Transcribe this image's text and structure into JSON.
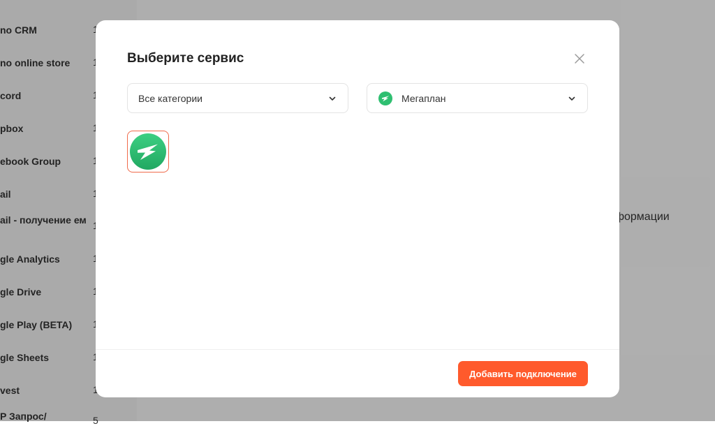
{
  "background": {
    "sidebar_items": [
      {
        "label": "no CRM",
        "count": "1"
      },
      {
        "label": "no online store",
        "count": "1"
      },
      {
        "label": "cord",
        "count": "1"
      },
      {
        "label": "pbox",
        "count": "1"
      },
      {
        "label": "ebook Group",
        "count": "1"
      },
      {
        "label": "ail",
        "count": "1"
      },
      {
        "label": "ail - получение ем",
        "count": "1"
      },
      {
        "label": "gle Analytics",
        "count": "1"
      },
      {
        "label": "gle Drive",
        "count": "1"
      },
      {
        "label": "gle Play (BETA)",
        "count": "1"
      },
      {
        "label": "gle Sheets",
        "count": "1"
      },
      {
        "label": "vest",
        "count": "1"
      },
      {
        "label": "P Запрос/",
        "count": "5"
      }
    ],
    "right_text": "нформации"
  },
  "modal": {
    "title": "Выберите сервис",
    "category_select": {
      "value": "Все категории"
    },
    "service_select": {
      "value": "Мегаплан",
      "icon": "megaplan-logo-icon"
    },
    "services": [
      {
        "name": "Мегаплан",
        "icon": "megaplan-logo-icon",
        "selected": true
      }
    ],
    "add_button_label": "Добавить подключение",
    "colors": {
      "accent": "#ff5a2c",
      "selected_border": "#f06a4a",
      "megaplan_green": "#2fbf71"
    }
  }
}
